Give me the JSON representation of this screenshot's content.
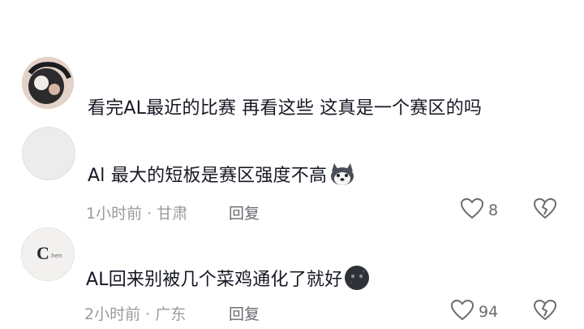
{
  "comments": [
    {
      "text": "看完AL最近的比赛 再看这些 这真是一个赛区的吗"
    },
    {
      "text": "Al 最大的短板是赛区强度不高",
      "emoji_icon": "husky-dog-emoji",
      "time": "1小时前",
      "location": "甘肃",
      "reply_label": "回复",
      "likes": "8"
    },
    {
      "text": "AL回来别被几个菜鸡通化了就好",
      "avatar_text": "C",
      "avatar_subtext": ".hen",
      "emoji_icon": "dark-moon-face-emoji",
      "time": "2小时前",
      "location": "广东",
      "reply_label": "回复",
      "likes": "94"
    }
  ]
}
